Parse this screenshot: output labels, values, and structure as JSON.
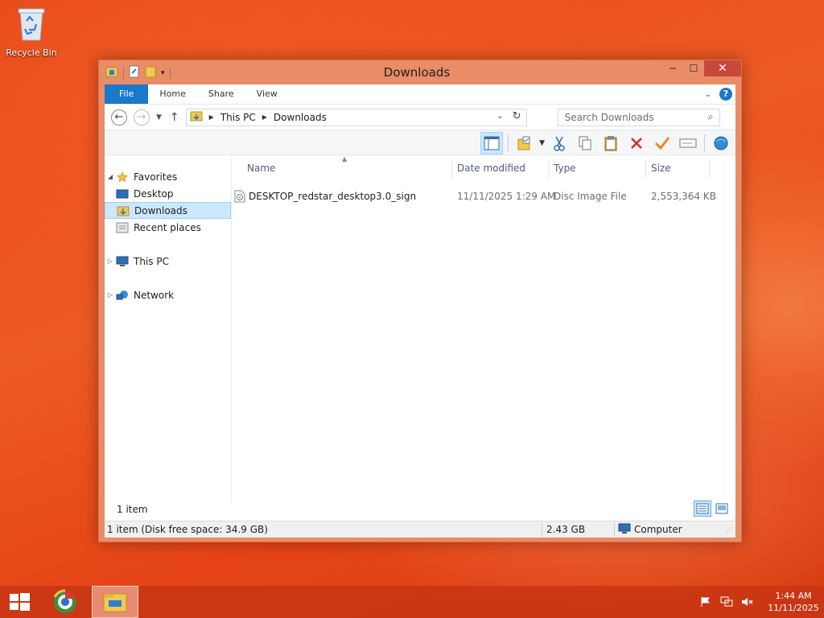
{
  "desktop": {
    "recycle_bin_label": "Recycle Bin"
  },
  "window": {
    "title": "Downloads",
    "controls": {
      "minimize": "─",
      "maximize": "☐",
      "close": "✕"
    }
  },
  "ribbon": {
    "tabs": [
      "File",
      "Home",
      "Share",
      "View"
    ]
  },
  "address": {
    "crumbs": [
      "This PC",
      "Downloads"
    ],
    "search_placeholder": "Search Downloads"
  },
  "navpane": {
    "favorites": "Favorites",
    "desktop": "Desktop",
    "downloads": "Downloads",
    "recent": "Recent places",
    "this_pc": "This PC",
    "network": "Network"
  },
  "columns": {
    "name": "Name",
    "date_modified": "Date modified",
    "type": "Type",
    "size": "Size"
  },
  "files": [
    {
      "name": "DESKTOP_redstar_desktop3.0_sign",
      "date_modified": "11/11/2025 1:29 AM",
      "type": "Disc Image File",
      "size": "2,553,364 KB"
    }
  ],
  "status": {
    "item_count": "1 item",
    "disk_info": "1 item (Disk free space: 34.9 GB)",
    "selected_size": "2.43 GB",
    "location": "Computer"
  },
  "taskbar": {
    "time": "1:44 AM",
    "date": "11/11/2025"
  },
  "colors": {
    "accent": "#1979ca",
    "window_frame": "#e98c67",
    "selection": "#cce8ff",
    "close_button": "#c7493d"
  }
}
